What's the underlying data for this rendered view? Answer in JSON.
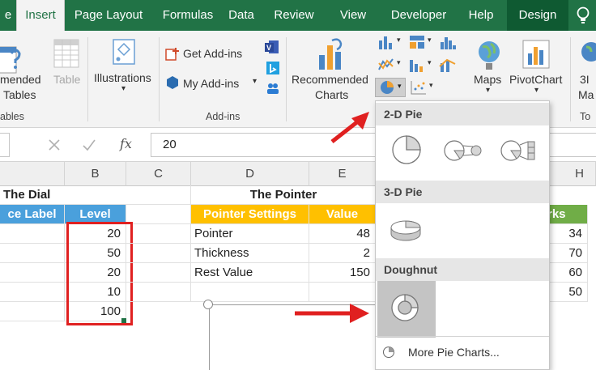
{
  "ribbon_tabs": [
    {
      "label": "e"
    },
    {
      "label": "Insert",
      "active": true
    },
    {
      "label": "Page Layout"
    },
    {
      "label": "Formulas"
    },
    {
      "label": "Data"
    },
    {
      "label": "Review"
    },
    {
      "label": "View"
    },
    {
      "label": "Developer"
    },
    {
      "label": "Help"
    },
    {
      "label": "Design"
    }
  ],
  "ribbon": {
    "recommended_tables": [
      "mended",
      "Tables"
    ],
    "table": "Table",
    "tables_group": "ables",
    "illustrations": "Illustrations",
    "get_addins": "Get Add-ins",
    "my_addins": "My Add-ins",
    "addins_group": "Add-ins",
    "recommended_charts": [
      "Recommended",
      "Charts"
    ],
    "maps": "Maps",
    "pivotchart": "PivotChart",
    "threed_partial": [
      "3I",
      "Ma"
    ],
    "tour_partial": "To"
  },
  "formula_bar": {
    "value": "20",
    "fx": "fx"
  },
  "columns": [
    "B",
    "C",
    "D",
    "E",
    "H"
  ],
  "dial": {
    "title": "The Dial",
    "headers": [
      "ce Label",
      "Level"
    ],
    "levels": [
      "20",
      "50",
      "20",
      "10",
      "100"
    ]
  },
  "pointer": {
    "title": "The Pointer",
    "headers": [
      "Pointer Settings",
      "Value"
    ],
    "rows": [
      {
        "label": "Pointer",
        "value": "48"
      },
      {
        "label": "Thickness",
        "value": "2"
      },
      {
        "label": "Rest Value",
        "value": "150"
      }
    ]
  },
  "marks": {
    "header": "rks",
    "values": [
      "34",
      "70",
      "60",
      "50"
    ]
  },
  "pie_menu": {
    "section_2d": "2-D Pie",
    "section_3d": "3-D Pie",
    "section_doughnut": "Doughnut",
    "more": "More Pie Charts..."
  },
  "colors": {
    "excel_green": "#217346",
    "accent_red": "#e02020",
    "dial_header_blue": "#4aa0dc",
    "pointer_header_orange": "#ffc000",
    "marks_header_green": "#70ad47"
  }
}
